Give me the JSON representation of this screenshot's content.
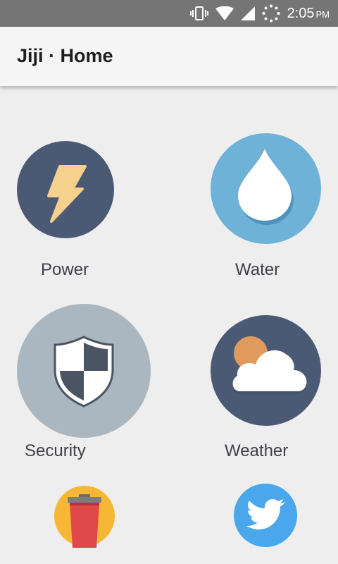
{
  "status_bar": {
    "time": "2:05",
    "ampm": "PM",
    "icons": [
      "vibrate-icon",
      "wifi-icon",
      "cell-signal-icon",
      "loading-icon"
    ]
  },
  "app_bar": {
    "title": "Jiji · Home"
  },
  "tiles": [
    {
      "label": "Power",
      "icon": "lightning-icon",
      "color": "#4b5a74"
    },
    {
      "label": "Water",
      "icon": "water-drop-icon",
      "color": "#6fb2d8"
    },
    {
      "label": "Security",
      "icon": "shield-icon",
      "color": "#aab7c0"
    },
    {
      "label": "Weather",
      "icon": "cloud-sun-icon",
      "color": "#4b5a74"
    },
    {
      "label": "",
      "icon": "trash-icon",
      "color": "#f7b736"
    },
    {
      "label": "",
      "icon": "twitter-icon",
      "color": "#4aa7ec"
    }
  ]
}
